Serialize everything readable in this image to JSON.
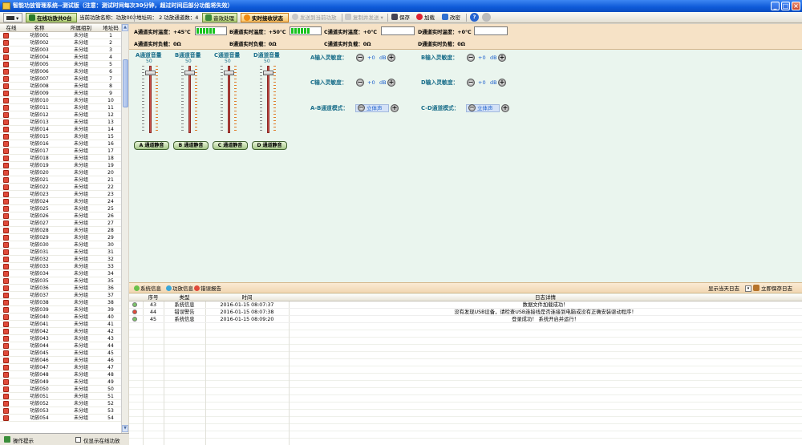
{
  "window": {
    "title": "智能功放管理系统--测试版（注意：测试时间每次30分钟，超过时间后部分功能将失效）"
  },
  "toolbar": {
    "online_count": "在线功放共0台",
    "current_amp": "当前功放名称：功放002",
    "address": "地址码： 2 功放通道数：4",
    "sound_process": "音效处理",
    "realtime_status": "实时接收状态",
    "send_data": "发送到当前功放",
    "copy_send": "复制并发送",
    "save": "保存",
    "load": "加载",
    "password": "改密"
  },
  "left": {
    "headers": [
      "在线",
      "名称",
      "所属组别",
      "地址码"
    ],
    "rows": [
      [
        "功放001",
        "未分组",
        "1"
      ],
      [
        "功放002",
        "未分组",
        "2"
      ],
      [
        "功放003",
        "未分组",
        "3"
      ],
      [
        "功放004",
        "未分组",
        "4"
      ],
      [
        "功放005",
        "未分组",
        "5"
      ],
      [
        "功放006",
        "未分组",
        "6"
      ],
      [
        "功放007",
        "未分组",
        "7"
      ],
      [
        "功放008",
        "未分组",
        "8"
      ],
      [
        "功放009",
        "未分组",
        "9"
      ],
      [
        "功放010",
        "未分组",
        "10"
      ],
      [
        "功放011",
        "未分组",
        "11"
      ],
      [
        "功放012",
        "未分组",
        "12"
      ],
      [
        "功放013",
        "未分组",
        "13"
      ],
      [
        "功放014",
        "未分组",
        "14"
      ],
      [
        "功放015",
        "未分组",
        "15"
      ],
      [
        "功放016",
        "未分组",
        "16"
      ],
      [
        "功放017",
        "未分组",
        "17"
      ],
      [
        "功放018",
        "未分组",
        "18"
      ],
      [
        "功放019",
        "未分组",
        "19"
      ],
      [
        "功放020",
        "未分组",
        "20"
      ],
      [
        "功放021",
        "未分组",
        "21"
      ],
      [
        "功放022",
        "未分组",
        "22"
      ],
      [
        "功放023",
        "未分组",
        "23"
      ],
      [
        "功放024",
        "未分组",
        "24"
      ],
      [
        "功放025",
        "未分组",
        "25"
      ],
      [
        "功放026",
        "未分组",
        "26"
      ],
      [
        "功放027",
        "未分组",
        "27"
      ],
      [
        "功放028",
        "未分组",
        "28"
      ],
      [
        "功放029",
        "未分组",
        "29"
      ],
      [
        "功放030",
        "未分组",
        "30"
      ],
      [
        "功放031",
        "未分组",
        "31"
      ],
      [
        "功放032",
        "未分组",
        "32"
      ],
      [
        "功放033",
        "未分组",
        "33"
      ],
      [
        "功放034",
        "未分组",
        "34"
      ],
      [
        "功放035",
        "未分组",
        "35"
      ],
      [
        "功放036",
        "未分组",
        "36"
      ],
      [
        "功放037",
        "未分组",
        "37"
      ],
      [
        "功放038",
        "未分组",
        "38"
      ],
      [
        "功放039",
        "未分组",
        "39"
      ],
      [
        "功放040",
        "未分组",
        "40"
      ],
      [
        "功放041",
        "未分组",
        "41"
      ],
      [
        "功放042",
        "未分组",
        "42"
      ],
      [
        "功放043",
        "未分组",
        "43"
      ],
      [
        "功放044",
        "未分组",
        "44"
      ],
      [
        "功放045",
        "未分组",
        "45"
      ],
      [
        "功放046",
        "未分组",
        "46"
      ],
      [
        "功放047",
        "未分组",
        "47"
      ],
      [
        "功放048",
        "未分组",
        "48"
      ],
      [
        "功放049",
        "未分组",
        "49"
      ],
      [
        "功放050",
        "未分组",
        "50"
      ],
      [
        "功放051",
        "未分组",
        "51"
      ],
      [
        "功放052",
        "未分组",
        "52"
      ],
      [
        "功放053",
        "未分组",
        "53"
      ],
      [
        "功放054",
        "未分组",
        "54"
      ]
    ],
    "op_hint": "操作提示",
    "only_online": "仅显示在线功放"
  },
  "temps": [
    {
      "label": "A通道实时温度：+45℃",
      "bars": 6
    },
    {
      "label": "B通道实时温度：+50℃",
      "bars": 6
    },
    {
      "label": "C通道实时温度：+0℃",
      "bars": 0
    },
    {
      "label": "D通道实时温度：+0℃",
      "bars": 0
    }
  ],
  "loads": [
    "A通道实时负载：0Ω",
    "B通道实时负载：0Ω",
    "C通道实时负载：0Ω",
    "D通道实时负载：0Ω"
  ],
  "volumes": [
    {
      "label": "A通道音量",
      "value": "50",
      "mute": "A 通道静音"
    },
    {
      "label": "B通道音量",
      "value": "50",
      "mute": "B 通道静音"
    },
    {
      "label": "C通道音量",
      "value": "50",
      "mute": "C 通道静音"
    },
    {
      "label": "D通道音量",
      "value": "50",
      "mute": "D 通道静音"
    }
  ],
  "sensitivity": [
    {
      "label": "A输入灵敏度：",
      "value": "+0",
      "unit": "dB"
    },
    {
      "label": "B输入灵敏度：",
      "value": "+0",
      "unit": "dB"
    },
    {
      "label": "C输入灵敏度：",
      "value": "+0",
      "unit": "dB"
    },
    {
      "label": "D输入灵敏度：",
      "value": "+0",
      "unit": "dB"
    }
  ],
  "modes": [
    {
      "label": "A-B通道模式：",
      "value": "立体声"
    },
    {
      "label": "C-D通道模式：",
      "value": "立体声"
    }
  ],
  "log": {
    "tabs": [
      "系统信息",
      "功放信息",
      "错误报告"
    ],
    "show_today": "显示当天日志",
    "save_now": "立即保存日志",
    "headers": [
      "序号",
      "类型",
      "时间",
      "日志详情"
    ],
    "rows": [
      {
        "no": "43",
        "type": "系统信息",
        "time": "2016-01-15 08:07:37",
        "detail": "数据文件加载成功！",
        "level": "info"
      },
      {
        "no": "44",
        "type": "错误警告",
        "time": "2016-01-15 08:07:38",
        "detail": "没有发现USB设备，请检查USB连接线是否连接到电脑或没有正确安装驱动程序！",
        "level": "error"
      },
      {
        "no": "45",
        "type": "系统信息",
        "time": "2016-01-15 08:09:20",
        "detail": "登录成功！ 系统开启并运行！",
        "level": "info"
      }
    ]
  },
  "colors": {
    "titlebar": "#0e5ad8",
    "panel": "#eaf5ee",
    "strip": "#f6e2c6",
    "meter": "#19c21f",
    "error": "#e04a3a"
  }
}
